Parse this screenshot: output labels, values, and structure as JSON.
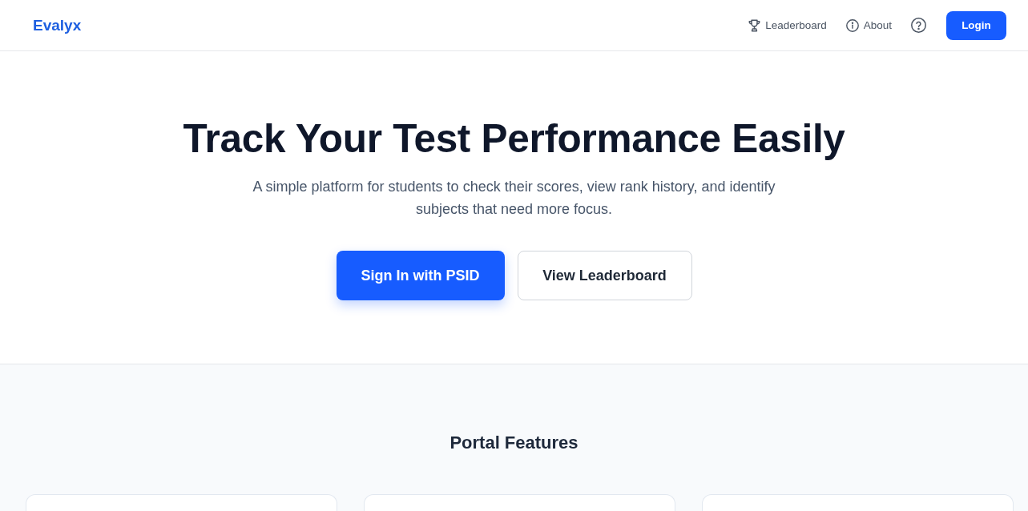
{
  "header": {
    "logo": "Evalyx",
    "nav": [
      {
        "kind": "trophy",
        "label": "Leaderboard"
      },
      {
        "kind": "info",
        "label": "About"
      },
      {
        "kind": "help"
      }
    ],
    "login": "Login"
  },
  "hero": {
    "title": "Track Your Test Performance Easily",
    "subtitle": "A simple platform for students to check their scores, view rank history, and identify subjects that need more focus.",
    "buttons": [
      {
        "kind": "primary",
        "label": "Sign In with PSID"
      },
      {
        "kind": "secondary",
        "label": "View Leaderboard"
      }
    ]
  },
  "features": {
    "title": "Portal Features",
    "cards": [
      {
        "kind": "feature"
      },
      {
        "kind": "feature"
      },
      {
        "kind": "feature"
      }
    ]
  }
}
